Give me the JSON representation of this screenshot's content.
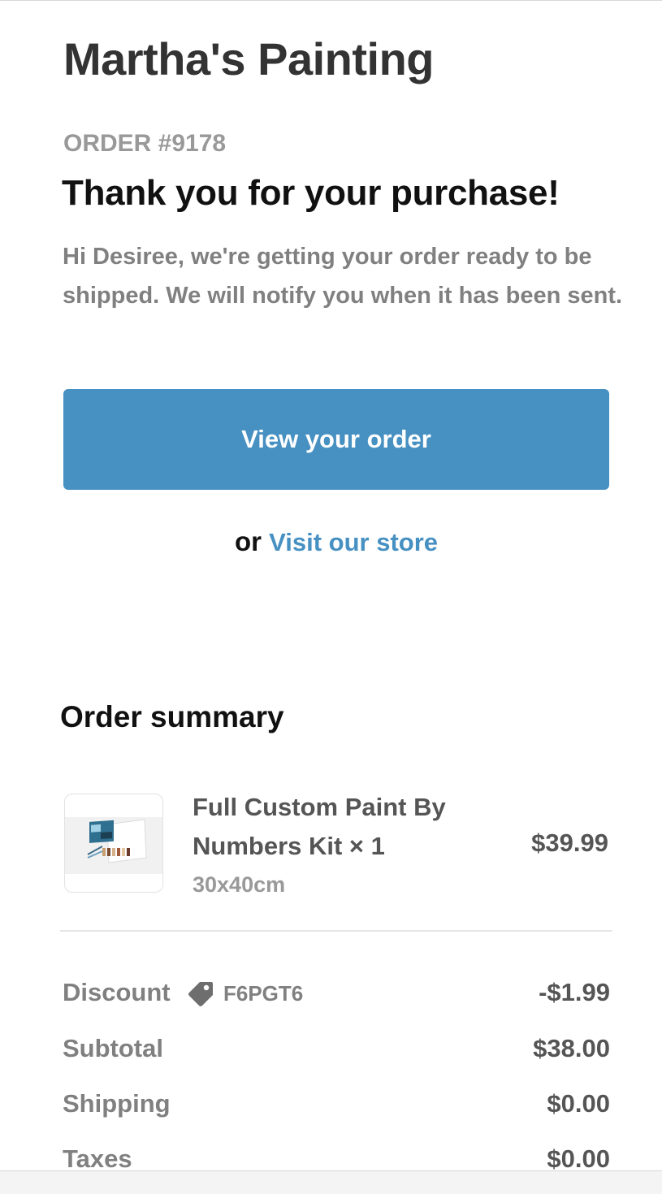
{
  "header": {
    "shop_name": "Martha's Painting",
    "order_number": "ORDER #9178",
    "heading": "Thank you for your purchase!",
    "message": "Hi Desiree, we're getting your order ready to be shipped. We will notify you when it has been sent."
  },
  "actions": {
    "view_order_label": "View your order",
    "or_text": "or",
    "visit_store_label": "Visit our store"
  },
  "summary": {
    "heading": "Order summary",
    "items": [
      {
        "title": "Full Custom Paint By Numbers Kit × 1",
        "variant": "30x40cm",
        "price": "$39.99",
        "thumbnail_icon": "paint-kit-thumbnail"
      }
    ],
    "rows": {
      "discount": {
        "label": "Discount",
        "code": "F6PGT6",
        "value": "-$1.99",
        "icon": "tag-icon"
      },
      "subtotal": {
        "label": "Subtotal",
        "value": "$38.00"
      },
      "shipping": {
        "label": "Shipping",
        "value": "$0.00"
      },
      "taxes": {
        "label": "Taxes",
        "value": "$0.00"
      }
    }
  },
  "colors": {
    "accent": "#4690c2",
    "text_dark": "#333333",
    "text_muted": "#808080"
  }
}
